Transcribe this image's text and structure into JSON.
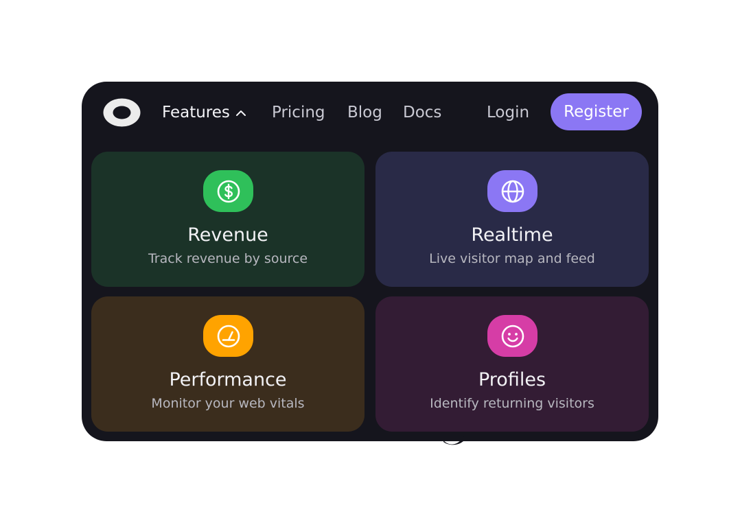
{
  "nav": {
    "features_label": "Features",
    "pricing_label": "Pricing",
    "blog_label": "Blog",
    "docs_label": "Docs",
    "login_label": "Login",
    "register_label": "Register"
  },
  "cards": [
    {
      "title": "Revenue",
      "description": "Track revenue by source",
      "icon": "dollar-circle-icon",
      "icon_color": "#2fc05a",
      "background": "#1b3328"
    },
    {
      "title": "Realtime",
      "description": "Live visitor map and feed",
      "icon": "globe-icon",
      "icon_color": "#8b77f4",
      "background": "#292a47"
    },
    {
      "title": "Performance",
      "description": "Monitor your web vitals",
      "icon": "gauge-icon",
      "icon_color": "#ffa300",
      "background": "#3b2d1d"
    },
    {
      "title": "Profiles",
      "description": "Identify returning visitors",
      "icon": "smiley-face-icon",
      "icon_color": "#d63da6",
      "background": "#331c34"
    }
  ],
  "colors": {
    "panel_background": "#15151d",
    "accent": "#8b77f4",
    "page_background": "#ffffff"
  }
}
